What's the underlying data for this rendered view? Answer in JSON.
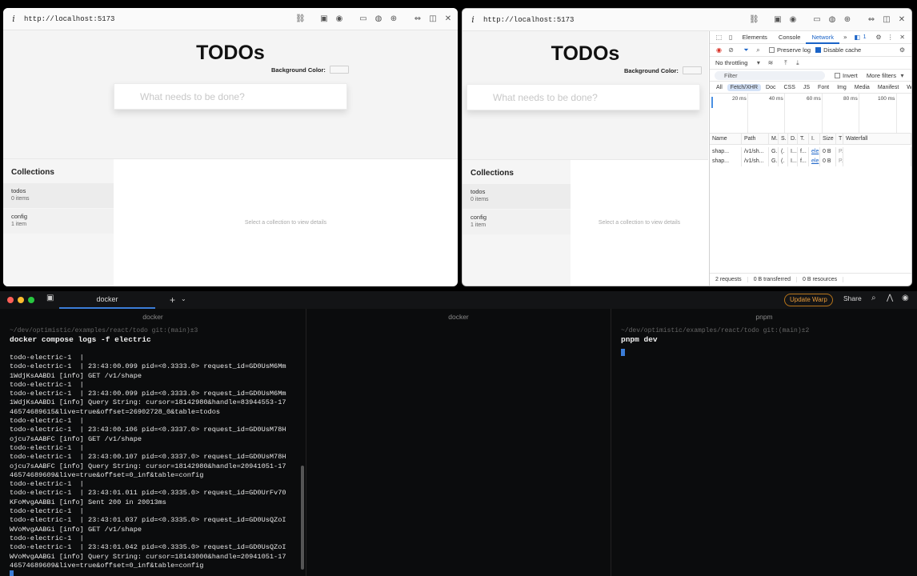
{
  "browser_left": {
    "url": "http://localhost:5173",
    "app": {
      "title": "TODOs",
      "bg_color_label": "Background Color:",
      "new_todo_placeholder": "What needs to be done?",
      "collections_heading": "Collections",
      "collections": [
        {
          "name": "todos",
          "count": "0 items"
        },
        {
          "name": "config",
          "count": "1 item"
        }
      ],
      "detail_placeholder": "Select a collection to view details"
    }
  },
  "browser_right": {
    "url": "http://localhost:5173",
    "app": {
      "title": "TODOs",
      "bg_color_label": "Background Color:",
      "new_todo_placeholder": "What needs to be done?",
      "collections_heading": "Collections",
      "collections": [
        {
          "name": "todos",
          "count": "0 items"
        },
        {
          "name": "config",
          "count": "1 item"
        }
      ],
      "detail_placeholder": "Select a collection to view details"
    },
    "devtools": {
      "tabs": [
        "Elements",
        "Console",
        "Network"
      ],
      "active_tab": "Network",
      "badge_count": "1",
      "preserve_log": "Preserve log",
      "disable_cache": "Disable cache",
      "throttling": "No throttling",
      "filter_placeholder": "Filter",
      "invert": "Invert",
      "more_filters": "More filters",
      "types": [
        "All",
        "Fetch/XHR",
        "Doc",
        "CSS",
        "JS",
        "Font",
        "Img",
        "Media",
        "Manifest",
        "WS"
      ],
      "active_type": "Fetch/XHR",
      "timeline_ticks": [
        "20 ms",
        "40 ms",
        "60 ms",
        "80 ms",
        "100 ms"
      ],
      "columns": [
        "Name",
        "Path",
        "M.",
        "S.",
        "D.",
        "T.",
        "I.",
        "Size",
        "T",
        "Waterfall"
      ],
      "rows": [
        {
          "name": "shap...",
          "path": "/v1/sh...",
          "m": "G.",
          "s": "(.",
          "d": "I...",
          "t": "f...",
          "i": "ele",
          "size": "0 B",
          "t2": "P."
        },
        {
          "name": "shap...",
          "path": "/v1/sh...",
          "m": "G.",
          "s": "(.",
          "d": "I...",
          "t": "f...",
          "i": "ele",
          "size": "0 B",
          "t2": "P."
        }
      ],
      "status": {
        "requests": "2 requests",
        "transferred": "0 B transferred",
        "resources": "0 B resources"
      }
    }
  },
  "terminal": {
    "tab_title": "docker",
    "update_label": "Update Warp",
    "share_label": "Share",
    "panes": [
      {
        "title": "docker",
        "path": "~/dev/optimistic/examples/react/todo git:(main)±3",
        "command": "docker compose logs -f electric",
        "logs": [
          "todo-electric-1  |",
          "todo-electric-1  | 23:43:00.099 pid=<0.3333.0> request_id=GD0UsM6Mm",
          "1WdjKsAABDi [info] GET /v1/shape",
          "todo-electric-1  |",
          "todo-electric-1  | 23:43:00.099 pid=<0.3333.0> request_id=GD0UsM6Mm",
          "1WdjKsAABDi [info] Query String: cursor=18142980&handle=83944553-17",
          "46574689615&live=true&offset=26902728_0&table=todos",
          "todo-electric-1  |",
          "todo-electric-1  | 23:43:00.106 pid=<0.3337.0> request_id=GD0UsM78H",
          "ojcu7sAABFC [info] GET /v1/shape",
          "todo-electric-1  |",
          "todo-electric-1  | 23:43:00.107 pid=<0.3337.0> request_id=GD0UsM78H",
          "ojcu7sAABFC [info] Query String: cursor=18142980&handle=20941051-17",
          "46574689609&live=true&offset=0_inf&table=config",
          "todo-electric-1  |",
          "todo-electric-1  | 23:43:01.011 pid=<0.3335.0> request_id=GD0UrFv70",
          "KFoMvgAABBi [info] Sent 200 in 20013ms",
          "todo-electric-1  |",
          "todo-electric-1  | 23:43:01.037 pid=<0.3335.0> request_id=GD0UsQZoI",
          "WVoMvgAABGi [info] GET /v1/shape",
          "todo-electric-1  |",
          "todo-electric-1  | 23:43:01.042 pid=<0.3335.0> request_id=GD0UsQZoI",
          "WVoMvgAABGi [info] Query String: cursor=18143000&handle=20941051-17",
          "46574689609&live=true&offset=0_inf&table=config"
        ]
      },
      {
        "title": "docker"
      },
      {
        "title": "pnpm",
        "path": "~/dev/optimistic/examples/react/todo git:(main)±2",
        "command": "pnpm dev"
      }
    ]
  },
  "colors": {
    "accent": "#1a63c7",
    "warp_accent": "#3b7dd8",
    "update_orange": "#e89b3a",
    "traffic_red": "#ff5f57",
    "traffic_yellow": "#febc2e",
    "traffic_green": "#28c840"
  }
}
